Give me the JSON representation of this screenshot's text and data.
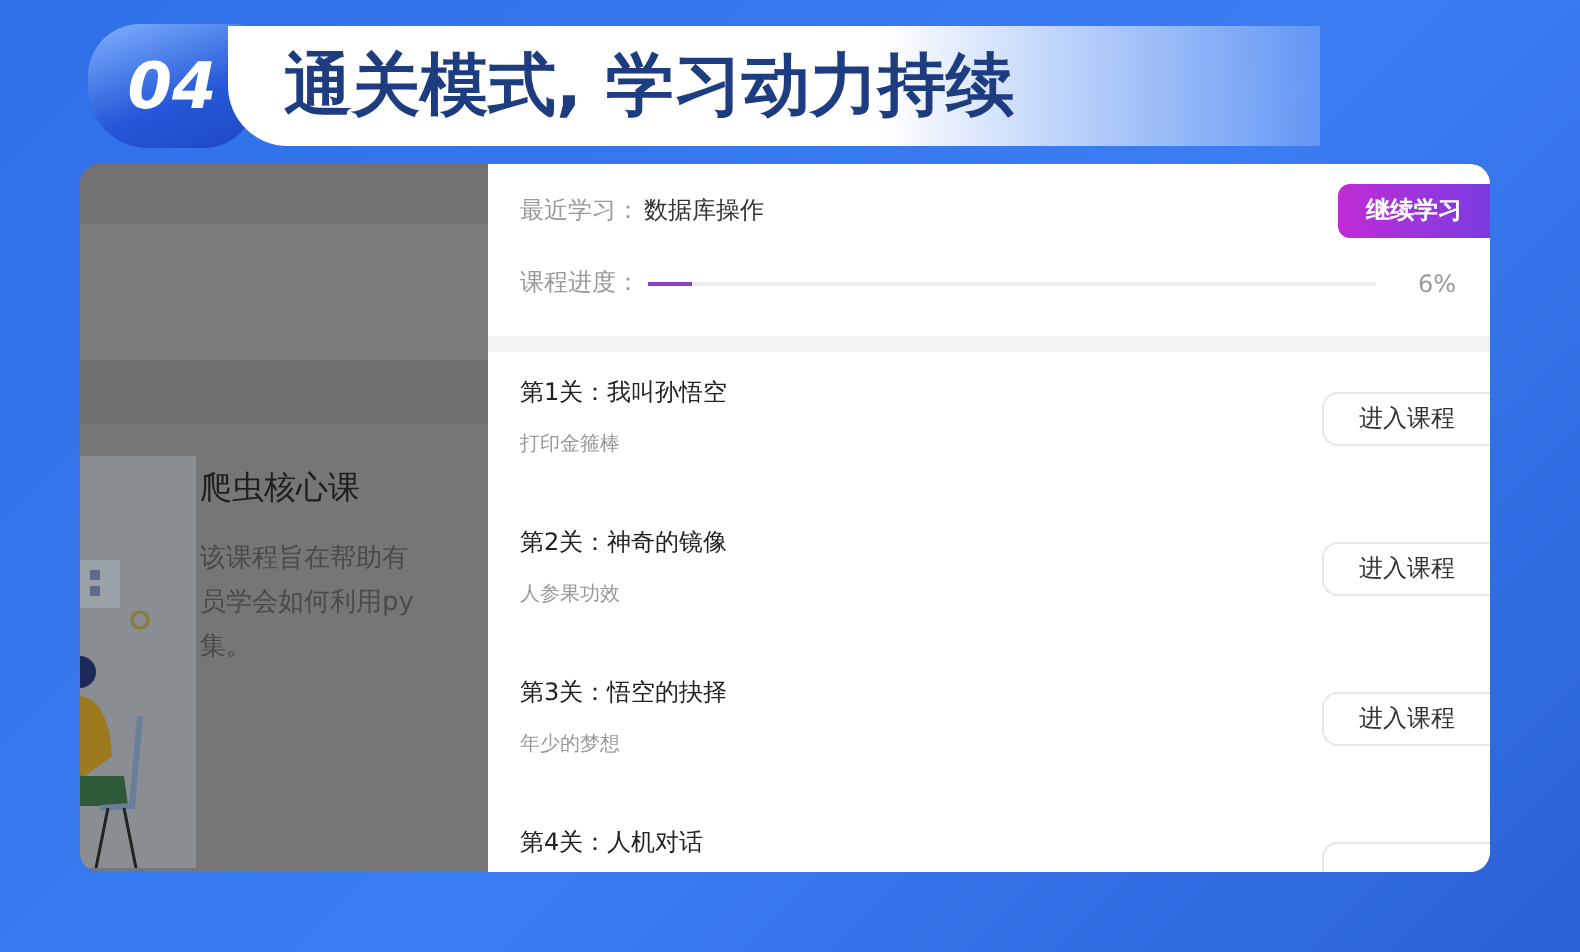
{
  "header": {
    "badge": "04",
    "title": "通关模式, 学习动力持续"
  },
  "background_course": {
    "title": "爬虫核心课",
    "description_lines": [
      "该课程旨在帮助有",
      "员学会如何利用py",
      "集。"
    ]
  },
  "progress_panel": {
    "recent_label": "最近学习：",
    "recent_course": "数据库操作",
    "continue_button": "继续学习",
    "progress_label": "课程进度：",
    "level": 0.06,
    "reading": "6%"
  },
  "levels": [
    {
      "title": "第1关：我叫孙悟空",
      "subtitle": "打印金箍棒",
      "button": "进入课程"
    },
    {
      "title": "第2关：神奇的镜像",
      "subtitle": "人参果功效",
      "button": "进入课程"
    },
    {
      "title": "第3关：悟空的抉择",
      "subtitle": "年少的梦想",
      "button": "进入课程"
    },
    {
      "title": "第4关：人机对话"
    }
  ]
}
